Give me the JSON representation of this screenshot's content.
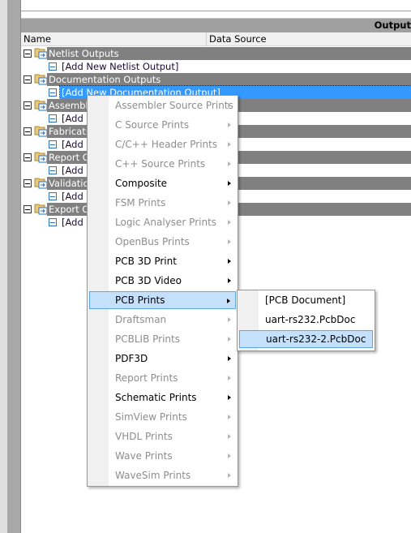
{
  "panel": {
    "title": "Output",
    "columns": [
      "Name",
      "Data Source"
    ]
  },
  "tree": [
    {
      "group": "Netlist Outputs",
      "add": "[Add New Netlist Output]"
    },
    {
      "group": "Documentation Outputs",
      "add": "[Add New Documentation Output]",
      "selected": true
    },
    {
      "group": "Assembly Outputs",
      "add": "[Add New Assembly Output]"
    },
    {
      "group": "Fabrication Outputs",
      "add": "[Add New Fabrication Output]"
    },
    {
      "group": "Report Outputs",
      "add": "[Add New Report Output]"
    },
    {
      "group": "Validation Outputs",
      "add": "[Add New Validation Output]"
    },
    {
      "group": "Export Outputs",
      "add": "[Add New Export Output]"
    }
  ],
  "context_menu": {
    "items": [
      {
        "label": "Assembler Source Prints",
        "enabled": false
      },
      {
        "label": "C Source Prints",
        "enabled": false
      },
      {
        "label": "C/C++ Header Prints",
        "enabled": false
      },
      {
        "label": "C++ Source Prints",
        "enabled": false
      },
      {
        "label": "Composite",
        "enabled": true
      },
      {
        "label": "FSM Prints",
        "enabled": false
      },
      {
        "label": "Logic Analyser Prints",
        "enabled": false
      },
      {
        "label": "OpenBus Prints",
        "enabled": false
      },
      {
        "label": "PCB 3D Print",
        "enabled": true
      },
      {
        "label": "PCB 3D Video",
        "enabled": true
      },
      {
        "label": "PCB Prints",
        "enabled": true,
        "highlighted": true
      },
      {
        "label": "Draftsman",
        "enabled": false
      },
      {
        "label": "PCBLIB Prints",
        "enabled": false
      },
      {
        "label": "PDF3D",
        "enabled": true
      },
      {
        "label": "Report Prints",
        "enabled": false
      },
      {
        "label": "Schematic Prints",
        "enabled": true
      },
      {
        "label": "SimView Prints",
        "enabled": false
      },
      {
        "label": "VHDL Prints",
        "enabled": false
      },
      {
        "label": "Wave Prints",
        "enabled": false
      },
      {
        "label": "WaveSim Prints",
        "enabled": false
      }
    ]
  },
  "submenu": {
    "items": [
      {
        "label": "[PCB Document]"
      },
      {
        "label": "uart-rs232.PcbDoc"
      },
      {
        "label": "uart-rs232-2.PcbDoc",
        "highlighted": true
      }
    ]
  },
  "colors": {
    "selection": "#3399ff",
    "group_row": "#808080",
    "menu_highlight": "#c4e0fb"
  }
}
